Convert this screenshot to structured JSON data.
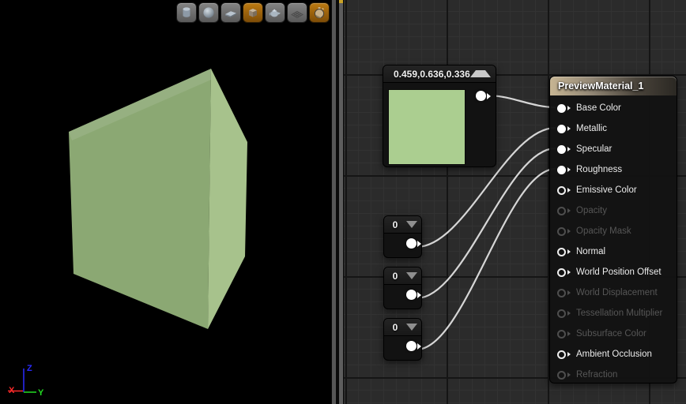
{
  "viewport": {
    "toolbar": {
      "buttons": [
        {
          "name": "cylinder",
          "active": false
        },
        {
          "name": "sphere",
          "active": false
        },
        {
          "name": "plane",
          "active": false
        },
        {
          "name": "cube",
          "active": true
        },
        {
          "name": "teapot",
          "active": false
        },
        {
          "name": "tessellated-plane",
          "active": false
        },
        {
          "name": "realtime-preview",
          "active": true
        }
      ]
    },
    "axis_gizmo": {
      "x_label": "X",
      "x_color": "#ff2a2a",
      "y_label": "Y",
      "y_color": "#22dd22",
      "z_label": "Z",
      "z_color": "#2a2aff"
    },
    "mesh": {
      "front_color": "#8ba873",
      "side_color": "#a7c28c"
    }
  },
  "graph": {
    "color_node": {
      "title": "0.459,0.636,0.336",
      "swatch_hex": "#abce90"
    },
    "scalar_nodes": [
      {
        "value": "0"
      },
      {
        "value": "0"
      },
      {
        "value": "0"
      }
    ],
    "material_node": {
      "title": "PreviewMaterial_1",
      "pins": [
        {
          "label": "Base Color",
          "state": "connected"
        },
        {
          "label": "Metallic",
          "state": "connected"
        },
        {
          "label": "Specular",
          "state": "connected"
        },
        {
          "label": "Roughness",
          "state": "connected"
        },
        {
          "label": "Emissive Color",
          "state": "enabled"
        },
        {
          "label": "Opacity",
          "state": "disabled"
        },
        {
          "label": "Opacity Mask",
          "state": "disabled"
        },
        {
          "label": "Normal",
          "state": "enabled"
        },
        {
          "label": "World Position Offset",
          "state": "enabled"
        },
        {
          "label": "World Displacement",
          "state": "disabled"
        },
        {
          "label": "Tessellation Multiplier",
          "state": "disabled"
        },
        {
          "label": "Subsurface Color",
          "state": "disabled"
        },
        {
          "label": "Ambient Occlusion",
          "state": "enabled"
        },
        {
          "label": "Refraction",
          "state": "disabled"
        }
      ]
    },
    "colors": {
      "wire": "#d6d6d6",
      "selection_orange": "#bd7b12",
      "grid_background": "#2b2b2b"
    }
  }
}
